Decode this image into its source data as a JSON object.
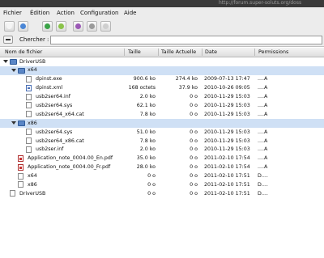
{
  "window": {
    "url_fragment": "http://forum.super-soluts.org/doss"
  },
  "menu": [
    "Fichier",
    "Édition",
    "Action",
    "Configuration",
    "Aide"
  ],
  "toolbar": [
    {
      "name": "new-archive-button",
      "icon": "new-file-icon",
      "color": "#f5f5f5"
    },
    {
      "name": "open-archive-button",
      "icon": "folder-open-icon",
      "color": "#4a86d6"
    },
    {
      "name": "extract-button",
      "icon": "extract-icon",
      "color": "#3aa347"
    },
    {
      "name": "add-files-button",
      "icon": "add-files-icon",
      "color": "#8bc34a"
    },
    {
      "name": "view-button",
      "icon": "view-icon",
      "color": "#9b59b6"
    },
    {
      "name": "test-button",
      "icon": "gear-icon",
      "color": "#9a9a9a"
    },
    {
      "name": "info-button",
      "icon": "info-icon",
      "color": "#cfcfcf"
    }
  ],
  "search": {
    "label": "Chercher :",
    "value": ""
  },
  "columns": [
    "Nom de fichier",
    "Taille",
    "Taille Actuelle",
    "Date",
    "Permissions"
  ],
  "rows": [
    {
      "name": "DriverUSB",
      "type": "dir",
      "level": 0,
      "expander": true,
      "size": "",
      "real": "",
      "date": "",
      "perm": ""
    },
    {
      "name": "x64",
      "type": "dir",
      "level": 1,
      "expander": true,
      "size": "",
      "real": "",
      "date": "",
      "perm": "",
      "selected": true
    },
    {
      "name": "dpinst.exe",
      "type": "file",
      "level": 2,
      "size": "900.6 ko",
      "real": "274.4 ko",
      "date": "2009-07-13 17:47",
      "perm": "....A"
    },
    {
      "name": "dpinst.xml",
      "type": "xml",
      "level": 2,
      "size": "168 octets",
      "real": "37.9 ko",
      "date": "2010-10-26 09:05",
      "perm": "....A"
    },
    {
      "name": "usb2ser64.inf",
      "type": "file",
      "level": 2,
      "size": "2.0 ko",
      "real": "0 o",
      "date": "2010-11-29 15:03",
      "perm": "....A"
    },
    {
      "name": "usb2ser64.sys",
      "type": "file",
      "level": 2,
      "size": "62.1 ko",
      "real": "0 o",
      "date": "2010-11-29 15:03",
      "perm": "....A"
    },
    {
      "name": "usb2ser64_x64.cat",
      "type": "file",
      "level": 2,
      "size": "7.8 ko",
      "real": "0 o",
      "date": "2010-11-29 15:03",
      "perm": "....A"
    },
    {
      "name": "x86",
      "type": "dir",
      "level": 1,
      "expander": true,
      "size": "",
      "real": "",
      "date": "",
      "perm": "",
      "selected": true
    },
    {
      "name": "usb2ser64.sys",
      "type": "file",
      "level": 2,
      "size": "51.0 ko",
      "real": "0 o",
      "date": "2010-11-29 15:03",
      "perm": "....A"
    },
    {
      "name": "usb2ser64_x86.cat",
      "type": "file",
      "level": 2,
      "size": "7.8 ko",
      "real": "0 o",
      "date": "2010-11-29 15:03",
      "perm": "....A"
    },
    {
      "name": "usb2ser.inf",
      "type": "file",
      "level": 2,
      "size": "2.0 ko",
      "real": "0 o",
      "date": "2010-11-29 15:03",
      "perm": "....A"
    },
    {
      "name": "Application_note_0004.00_En.pdf",
      "type": "pdf",
      "level": 1,
      "size": "35.0 ko",
      "real": "0 o",
      "date": "2011-02-10 17:54",
      "perm": "....A"
    },
    {
      "name": "Application_note_0004.00_Fr.pdf",
      "type": "pdf",
      "level": 1,
      "size": "28.0 ko",
      "real": "0 o",
      "date": "2011-02-10 17:54",
      "perm": "....A"
    },
    {
      "name": "x64",
      "type": "file",
      "level": 1,
      "size": "0 o",
      "real": "0 o",
      "date": "2011-02-10 17:51",
      "perm": "D...."
    },
    {
      "name": "x86",
      "type": "file",
      "level": 1,
      "size": "0 o",
      "real": "0 o",
      "date": "2011-02-10 17:51",
      "perm": "D...."
    },
    {
      "name": "DriverUSB",
      "type": "file",
      "level": 0,
      "size": "0 o",
      "real": "0 o",
      "date": "2011-02-10 17:51",
      "perm": "D...."
    }
  ]
}
